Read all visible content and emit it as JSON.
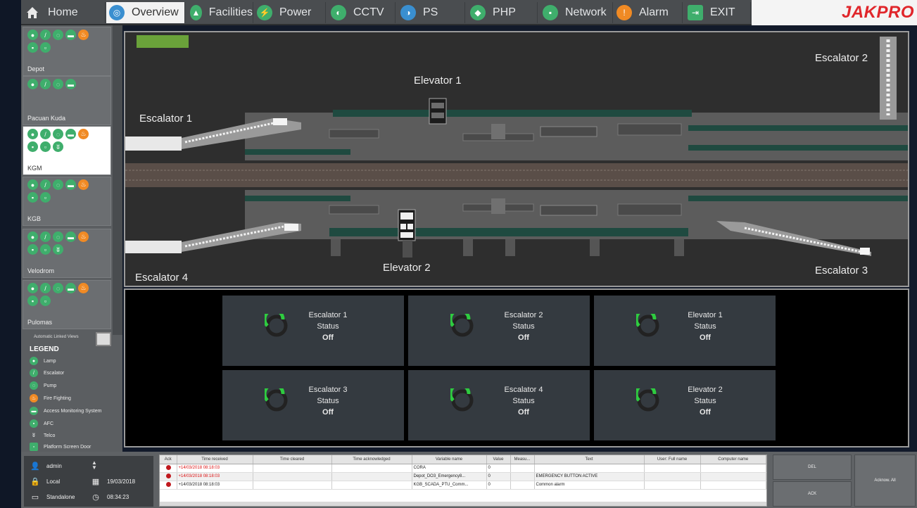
{
  "menu": {
    "items": [
      {
        "label": "Home",
        "icon": "home-icon"
      },
      {
        "label": "Overview",
        "icon": "overview-icon"
      },
      {
        "label": "Facilities",
        "icon": "facilities-icon"
      },
      {
        "label": "Power",
        "icon": "power-icon"
      },
      {
        "label": "CCTV",
        "icon": "cctv-icon"
      },
      {
        "label": "PS",
        "icon": "ps-icon"
      },
      {
        "label": "PHP",
        "icon": "php-icon"
      },
      {
        "label": "Network",
        "icon": "network-icon"
      },
      {
        "label": "Alarm",
        "icon": "alarm-icon"
      },
      {
        "label": "EXIT",
        "icon": "exit-icon"
      }
    ],
    "active": "Overview",
    "brand": "JAKPRO"
  },
  "stations": [
    {
      "name": "Depot"
    },
    {
      "name": "Pacuan Kuda"
    },
    {
      "name": "KGM"
    },
    {
      "name": "KGB"
    },
    {
      "name": "Velodrom"
    },
    {
      "name": "Pulomas"
    }
  ],
  "sidebar": {
    "auto_label": "Automatic Linked Views",
    "legend_title": "LEGEND",
    "legend": [
      {
        "label": "Lamp",
        "icon": "lamp-icon"
      },
      {
        "label": "Escalator",
        "icon": "escalator-icon"
      },
      {
        "label": "Pump",
        "icon": "pump-icon"
      },
      {
        "label": "Fire Fighting",
        "icon": "fire-icon"
      },
      {
        "label": "Access Monitoring System",
        "icon": "ams-icon"
      },
      {
        "label": "AFC",
        "icon": "afc-icon"
      },
      {
        "label": "Telco",
        "icon": "telco-icon"
      },
      {
        "label": "Platform Screen Door",
        "icon": "psd-icon"
      }
    ]
  },
  "map": {
    "labels": {
      "escalator1": "Escalator 1",
      "escalator2": "Escalator 2",
      "escalator3": "Escalator 3",
      "escalator4": "Escalator 4",
      "elevator1": "Elevator 1",
      "elevator2": "Elevator 2"
    }
  },
  "status_cards": [
    {
      "name": "Escalator 1",
      "caption": "Status",
      "state": "Off"
    },
    {
      "name": "Escalator 2",
      "caption": "Status",
      "state": "Off"
    },
    {
      "name": "Elevator 1",
      "caption": "Status",
      "state": "Off"
    },
    {
      "name": "Escalator 3",
      "caption": "Status",
      "state": "Off"
    },
    {
      "name": "Escalator 4",
      "caption": "Status",
      "state": "Off"
    },
    {
      "name": "Elevator 2",
      "caption": "Status",
      "state": "Off"
    }
  ],
  "user": {
    "name": "admin",
    "location": "Local",
    "date": "19/03/2018",
    "mode": "Standalone",
    "time": "08:34:23"
  },
  "alarm_table": {
    "columns": [
      "Ack",
      "Time received",
      "Time cleared",
      "Time acknowledged",
      "Variable name",
      "Value",
      "Measu...",
      "Text",
      "User: Full name",
      "Computer name"
    ],
    "rows": [
      [
        "",
        "+14/03/2018 08:18:03",
        "",
        "",
        "CORA",
        "0",
        "",
        "",
        "",
        ""
      ],
      [
        "",
        "+14/03/2018 08:18:03",
        "",
        "",
        "Depot_DO3_Emergency8...",
        "0",
        "",
        "EMERGENCY BUTTON ACTIVE",
        "",
        ""
      ],
      [
        "",
        "+14/03/2018 08:18:03",
        "",
        "",
        "KGB_SCADA_PTU_Comm...",
        "0",
        "",
        "Common alarm",
        "",
        ""
      ]
    ]
  },
  "buttons": {
    "del": "DEL",
    "ack": "ACK",
    "ackall": "Acknow. All"
  }
}
